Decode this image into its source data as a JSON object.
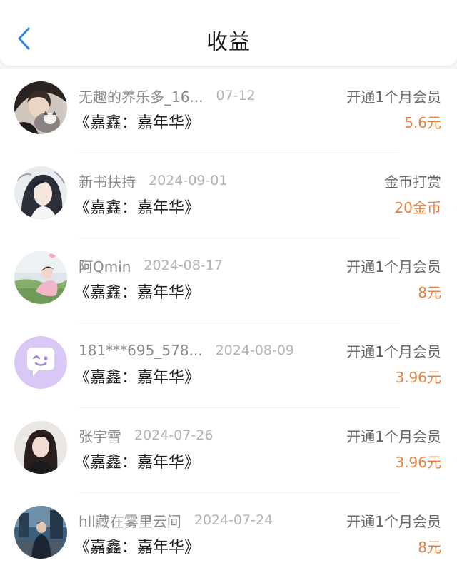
{
  "header": {
    "title": "收益",
    "back_icon": "chevron-left-icon",
    "accent_color": "#2f86e6"
  },
  "earnings_color": "#e7803e",
  "items": [
    {
      "user": "无趣的养乐多_16...",
      "date": "07-12",
      "book": "《嘉鑫：嘉年华》",
      "type": "开通1个月会员",
      "amount": "5.6元",
      "avatar": "avatar-woman-with-cat-icon"
    },
    {
      "user": "新书扶持",
      "date": "2024-09-01",
      "book": "《嘉鑫：嘉年华》",
      "type": "金币打赏",
      "amount": "20金币",
      "avatar": "avatar-anime-character-icon"
    },
    {
      "user": "阿Qmin",
      "date": "2024-08-17",
      "book": "《嘉鑫：嘉年华》",
      "type": "开通1个月会员",
      "amount": "8元",
      "avatar": "avatar-photo-outdoor-icon"
    },
    {
      "user": "181***695_578...",
      "date": "2024-08-09",
      "book": "《嘉鑫：嘉年华》",
      "type": "开通1个月会员",
      "amount": "3.96元",
      "avatar": "avatar-default-chat-icon"
    },
    {
      "user": "张宇雪",
      "date": "2024-07-26",
      "book": "《嘉鑫：嘉年华》",
      "type": "开通1个月会员",
      "amount": "3.96元",
      "avatar": "avatar-portrait-girl-icon"
    },
    {
      "user": "hll藏在雾里云间",
      "date": "2024-07-24",
      "book": "《嘉鑫：嘉年华》",
      "type": "开通1个月会员",
      "amount": "8元",
      "avatar": "avatar-photo-street-icon"
    }
  ]
}
